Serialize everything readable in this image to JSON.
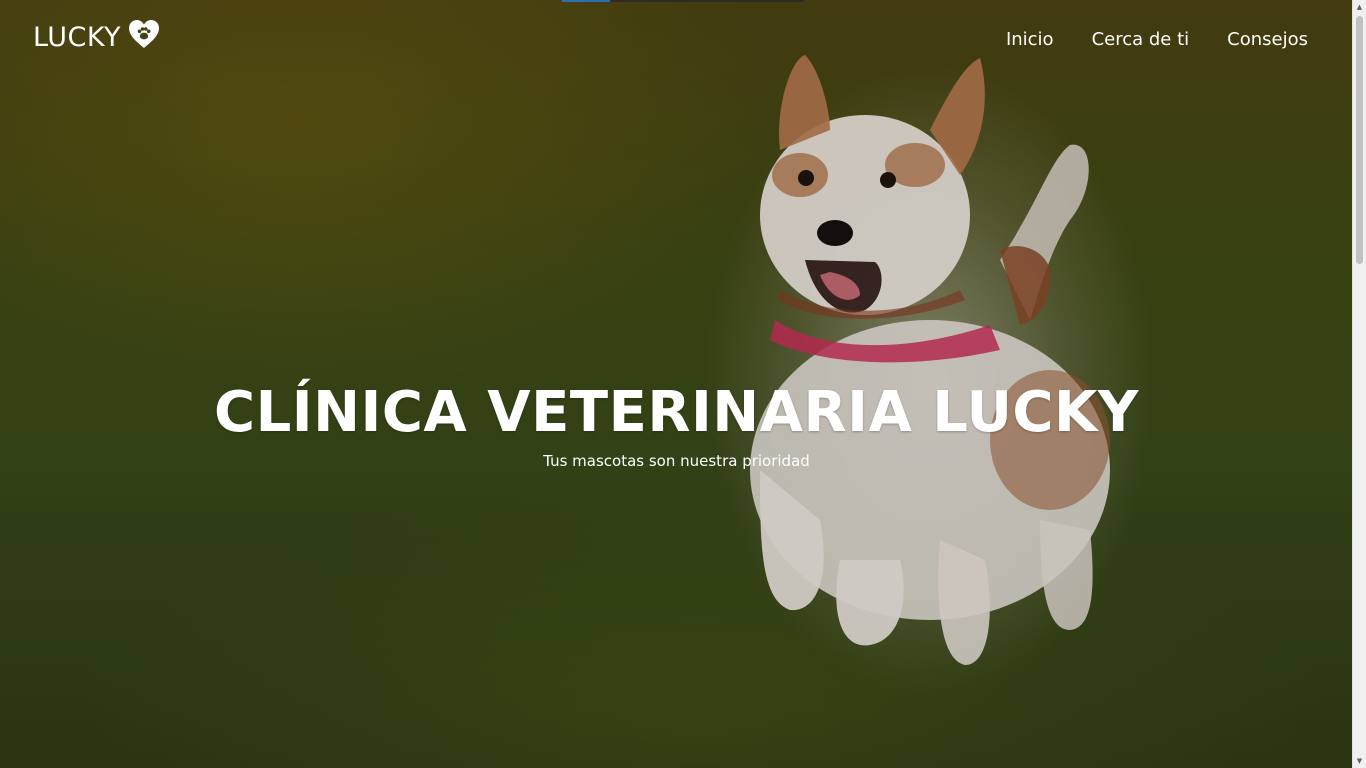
{
  "navbar": {
    "brand_label": "LUCKY",
    "brand_icon": "heart-paw-icon",
    "links": [
      {
        "label": "Inicio"
      },
      {
        "label": "Cerca de ti"
      },
      {
        "label": "Consejos"
      }
    ]
  },
  "hero": {
    "title": "CLÍNICA VETERINARIA LUCKY",
    "subtitle": "Tus mascotas son nuestra prioridad",
    "image": "running-dog-on-grass"
  },
  "colors": {
    "text": "#ffffff",
    "accent": "#2d6fb0",
    "grass_dark": "#2f3c14",
    "grass_light": "#4b4412"
  },
  "scrollbar": {
    "position": 0.0
  }
}
